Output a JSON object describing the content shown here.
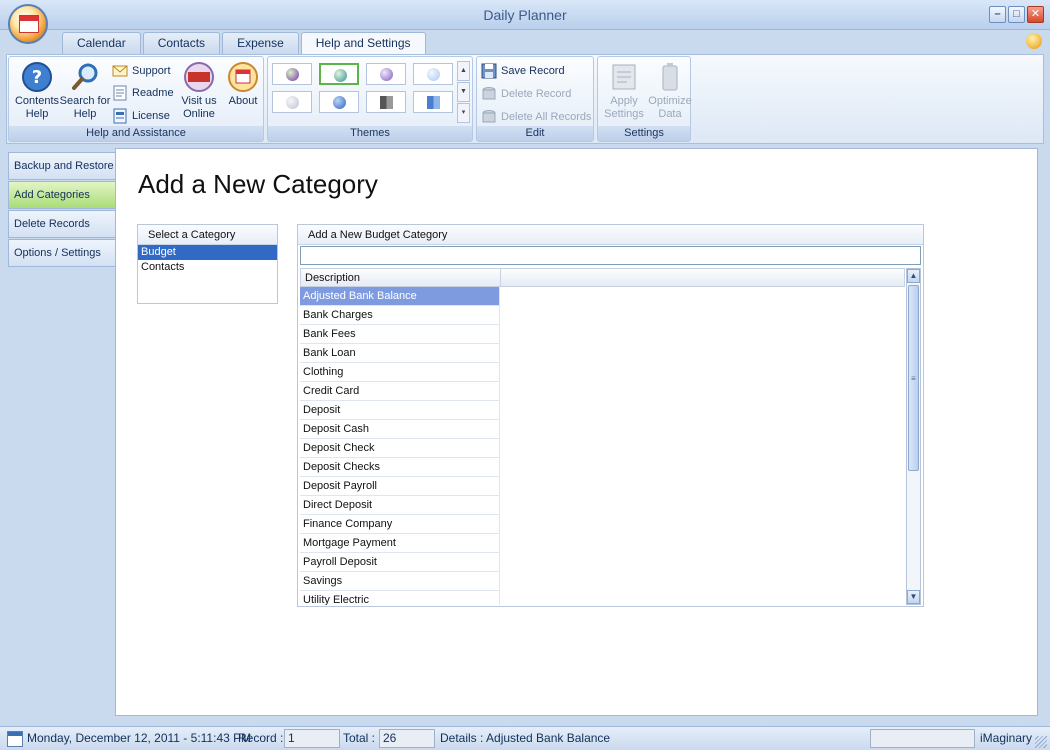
{
  "window": {
    "title": "Daily Planner"
  },
  "ribbon": {
    "tabs": [
      {
        "label": "Calendar"
      },
      {
        "label": "Contacts"
      },
      {
        "label": "Expense"
      },
      {
        "label": "Help and Settings",
        "active": true
      }
    ],
    "groups": {
      "help": {
        "label": "Help and Assistance",
        "contents_help": "Contents Help",
        "search_help": "Search for Help",
        "support": "Support",
        "readme": "Readme",
        "license": "License",
        "visit": "Visit us Online",
        "about": "About"
      },
      "themes": {
        "label": "Themes"
      },
      "edit": {
        "label": "Edit",
        "save": "Save Record",
        "delete": "Delete Record",
        "delete_all": "Delete All Records"
      },
      "settings": {
        "label": "Settings",
        "apply": "Apply Settings",
        "optimize": "Optimize Data"
      }
    }
  },
  "sidebar": {
    "items": [
      {
        "label": "Backup and Restore"
      },
      {
        "label": "Add Categories",
        "active": true
      },
      {
        "label": "Delete Records"
      },
      {
        "label": "Options / Settings"
      }
    ]
  },
  "main": {
    "title": "Add a New Category",
    "category_box": {
      "header": "Select a Category",
      "items": [
        "Budget",
        "Contacts"
      ],
      "selected": "Budget"
    },
    "budget_box": {
      "header": "Add a New Budget Category",
      "input_value": "",
      "column": "Description",
      "rows": [
        "Adjusted Bank Balance",
        "Bank Charges",
        "Bank Fees",
        "Bank Loan",
        "Clothing",
        "Credit Card",
        "Deposit",
        "Deposit Cash",
        "Deposit Check",
        "Deposit Checks",
        "Deposit Payroll",
        "Direct Deposit",
        "Finance Company",
        "Mortgage Payment",
        "Payroll Deposit",
        "Savings",
        "Utility Electric"
      ],
      "selected_row": "Adjusted Bank Balance"
    }
  },
  "status": {
    "datetime": "Monday, December 12, 2011 - 5:11:43 PM",
    "record_label": "Record :",
    "record_value": "1",
    "total_label": "Total :",
    "total_value": "26",
    "details": "Details : Adjusted Bank Balance",
    "brand": "iMaginary"
  },
  "colors": {
    "accent": "#316ac5",
    "row_selected": "#7f9be0",
    "active_tab": "#a9dc77",
    "close_button": "#d6482a"
  }
}
